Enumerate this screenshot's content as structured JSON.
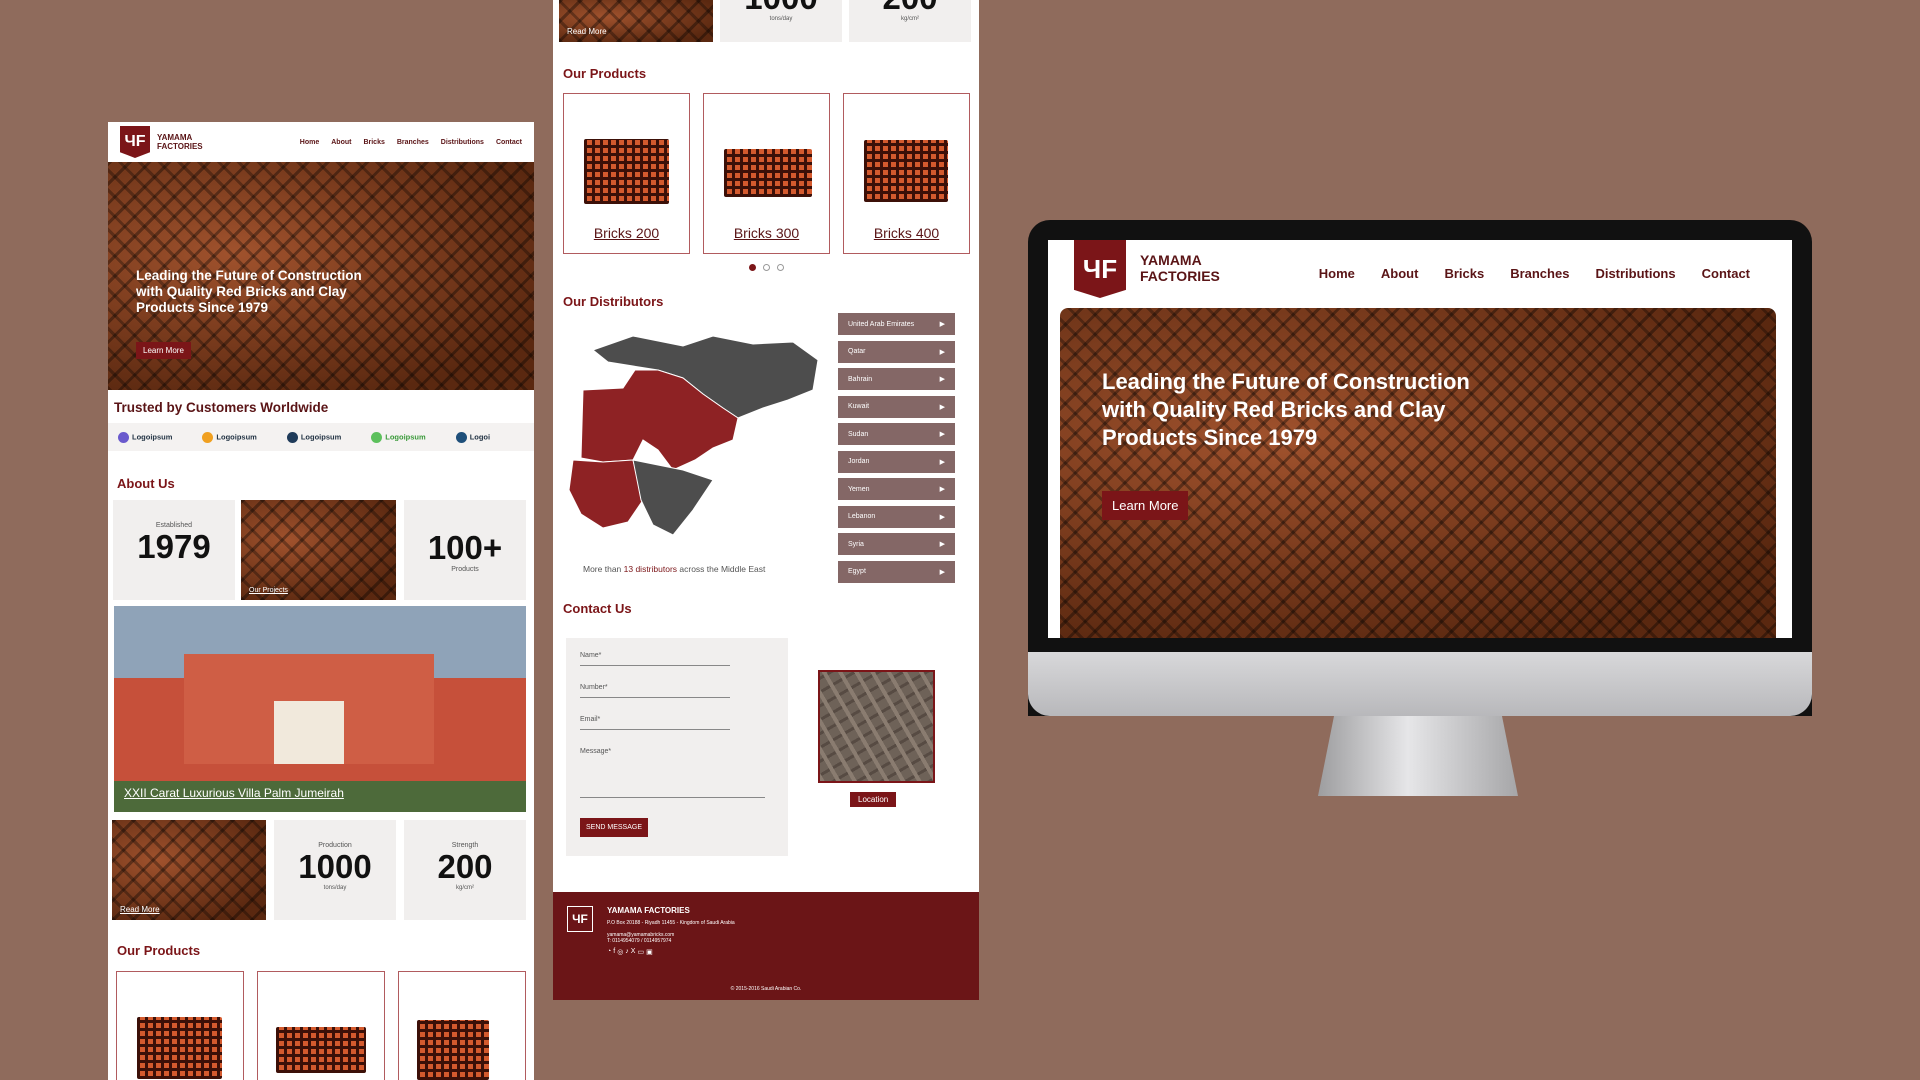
{
  "brand": {
    "name_line1": "YAMAMA",
    "name_line2": "FACTORIES",
    "monogram": "ЧF"
  },
  "nav": [
    "Home",
    "About",
    "Bricks",
    "Branches",
    "Distributions",
    "Contact"
  ],
  "hero": {
    "headline": "Leading the Future of Construction with Quality Red Bricks and Clay Products Since 1979",
    "button": "Learn More"
  },
  "trusted": {
    "title": "Trusted by Customers Worldwide",
    "logos": [
      "Logoipsum",
      "Logoipsum",
      "Logoipsum",
      "Logoipsum",
      "Logoi"
    ]
  },
  "about": {
    "title": "About Us",
    "established_label": "Established",
    "established_value": "1979",
    "projects_link": "Our Projects",
    "products_value": "100+",
    "products_label": "Products",
    "villa_caption": "XXII Carat Luxurious Villa Palm Jumeirah",
    "read_more": "Read More",
    "production_label": "Production",
    "production_value": "1000",
    "production_unit": "tons/day",
    "strength_label": "Strength",
    "strength_value": "200",
    "strength_unit": "kg/cm²"
  },
  "products": {
    "title": "Our Products",
    "items": [
      "Bricks 200",
      "Bricks 300",
      "Bricks 400"
    ]
  },
  "distributors": {
    "title": "Our Distributors",
    "countries": [
      "United Arab Emirates",
      "Qatar",
      "Bahrain",
      "Kuwait",
      "Sudan",
      "Jordan",
      "Yemen",
      "Lebanon",
      "Syria",
      "Egypt"
    ],
    "note_prefix": "More than ",
    "note_highlight": "13 distributors",
    "note_suffix": " across the Middle East"
  },
  "contact": {
    "title": "Contact Us",
    "fields": [
      "Name*",
      "Number*",
      "Email*",
      "Message*"
    ],
    "send": "SEND MESSAGE",
    "location": "Location"
  },
  "footer": {
    "name": "YAMAMA FACTORIES",
    "address": "P.O Box 20188 - Riyadh 11455 - Kingdom of Saudi Arabia",
    "email": "yamama@yamamabricks.com",
    "phone": "T: 0114954079 / 0114957974",
    "copyright": "© 2015-2016 Saudi Arabian Co."
  },
  "colors": {
    "background": "#8f6b5c",
    "brand": "#7b1518",
    "footer": "#6b1517",
    "distributor_item": "#846766"
  }
}
